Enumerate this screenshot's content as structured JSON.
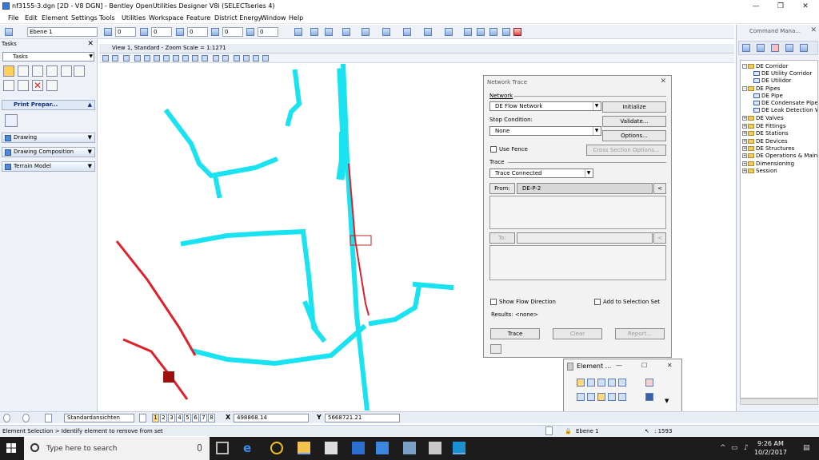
{
  "window": {
    "title": "nf3155-3.dgn [2D - V8 DGN] - Bentley OpenUtilities Designer V8i (SELECTseries 4)",
    "minimize": "—",
    "restore": "❐",
    "close": "✕"
  },
  "menu": [
    "File",
    "Edit",
    "Element",
    "Settings",
    "Tools",
    "Utilities",
    "Workspace",
    "Feature",
    "District Energy",
    "Window",
    "Help"
  ],
  "toolbar": {
    "level": "Ebene 1",
    "weight1": "0",
    "weight2": "0",
    "weight3": "0",
    "weight4": "0",
    "weight5": "0"
  },
  "tasks": {
    "header": "Tasks",
    "close": "✕",
    "selector": "Tasks",
    "print_prep": "Print Prepar...",
    "sections": [
      "Drawing",
      "Drawing Composition",
      "Terrain Model"
    ]
  },
  "view": {
    "title": "View 1, Standard - Zoom Scale = 1:1271"
  },
  "network_trace": {
    "title": "Network Trace",
    "close": "✕",
    "network_label": "Network",
    "network_value": "DE Flow Network",
    "initialize": "Initialize",
    "stop_label": "Stop Condition:",
    "stop_value": "None",
    "validate": "Validate...",
    "options": "Options...",
    "use_fence": "Use Fence",
    "cross_section": "Cross Section Options...",
    "trace_label": "Trace",
    "trace_value": "Trace Connected",
    "from_btn": "From:",
    "from_value": "DE-P-2",
    "arrow": "<",
    "to_btn": "To:",
    "show_flow": "Show Flow Direction",
    "add_selection": "Add to Selection Set",
    "results": "Results: <none>",
    "trace_btn": "Trace",
    "clear_btn": "Clear",
    "report_btn": "Report..."
  },
  "element_selection": {
    "title": "Element ...",
    "close": "✕",
    "restore": "☐",
    "minimize": "—"
  },
  "command_manager": {
    "title": "Command Mana...",
    "close": "✕",
    "tree": [
      {
        "label": "DE Corridor",
        "level": 0,
        "type": "folder",
        "expand": "-"
      },
      {
        "label": "DE Utility Corridor",
        "level": 1,
        "type": "leaf"
      },
      {
        "label": "DE Utilidor",
        "level": 1,
        "type": "leaf"
      },
      {
        "label": "DE Pipes",
        "level": 0,
        "type": "folder",
        "expand": "-"
      },
      {
        "label": "DE Pipe",
        "level": 1,
        "type": "leaf"
      },
      {
        "label": "DE Condensate Pipe",
        "level": 1,
        "type": "leaf"
      },
      {
        "label": "DE Leak Detection W",
        "level": 1,
        "type": "leaf"
      },
      {
        "label": "DE Valves",
        "level": 0,
        "type": "folder",
        "expand": "+"
      },
      {
        "label": "DE Fittings",
        "level": 0,
        "type": "folder",
        "expand": "+"
      },
      {
        "label": "DE Stations",
        "level": 0,
        "type": "folder",
        "expand": "+"
      },
      {
        "label": "DE Devices",
        "level": 0,
        "type": "folder",
        "expand": "+"
      },
      {
        "label": "DE Structures",
        "level": 0,
        "type": "folder",
        "expand": "+"
      },
      {
        "label": "DE Operations & Mainte",
        "level": 0,
        "type": "folder",
        "expand": "+"
      },
      {
        "label": "Dimensioning",
        "level": 0,
        "type": "folder",
        "expand": "+"
      },
      {
        "label": "Session",
        "level": 0,
        "type": "folder",
        "expand": "+"
      }
    ]
  },
  "view_bar": {
    "view_name": "Standardansichten",
    "views": [
      "1",
      "2",
      "3",
      "4",
      "5",
      "6",
      "7",
      "8"
    ],
    "x_label": "X",
    "x_value": "498868.14",
    "y_label": "Y",
    "y_value": "5668721.21"
  },
  "status": {
    "message": "Element Selection > Identify element to remove from set",
    "level": "Ebene 1",
    "count": ": 1593"
  },
  "taskbar": {
    "search_placeholder": "Type here to search",
    "time": "9:26 AM",
    "date": "10/2/2017"
  },
  "colors": {
    "network": "#19e3f0",
    "highlight": "#e0202a",
    "accent": "#3a7bd5"
  }
}
